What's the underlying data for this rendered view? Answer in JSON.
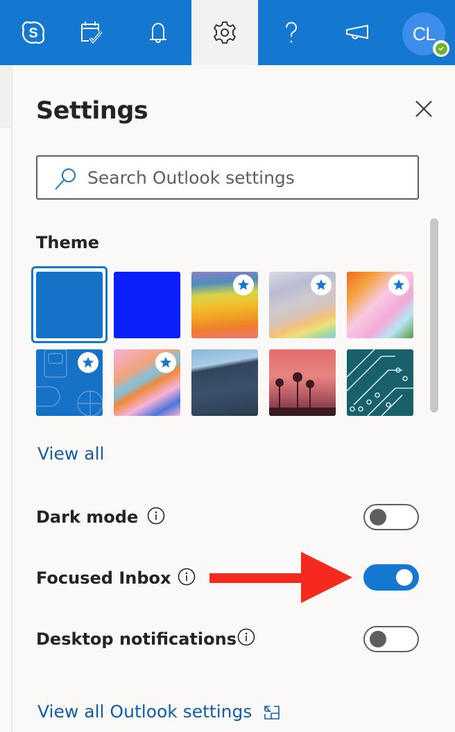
{
  "topbar": {
    "background": "#1478d0",
    "buttons": [
      {
        "name": "skype",
        "icon": "skype-icon"
      },
      {
        "name": "my-day",
        "icon": "calendar-check-icon"
      },
      {
        "name": "notifications",
        "icon": "bell-icon"
      },
      {
        "name": "settings",
        "icon": "gear-icon",
        "active": true
      },
      {
        "name": "help",
        "icon": "question-icon"
      },
      {
        "name": "whats-new",
        "icon": "megaphone-icon"
      }
    ],
    "avatar": {
      "initials": "CL",
      "presence": "available"
    }
  },
  "settings": {
    "title": "Settings",
    "close_icon": "close-icon",
    "search": {
      "placeholder": "Search Outlook settings",
      "value": ""
    },
    "theme": {
      "label": "Theme",
      "tiles": [
        {
          "name": "blue",
          "selected": true,
          "premium": false
        },
        {
          "name": "dark-blue",
          "selected": false,
          "premium": false
        },
        {
          "name": "rainbow-waves",
          "selected": false,
          "premium": true
        },
        {
          "name": "ribbons",
          "selected": false,
          "premium": true
        },
        {
          "name": "unicorn",
          "selected": false,
          "premium": true
        },
        {
          "name": "school-supplies",
          "selected": false,
          "premium": true
        },
        {
          "name": "board-game",
          "selected": false,
          "premium": true
        },
        {
          "name": "mountain",
          "selected": false,
          "premium": false
        },
        {
          "name": "palm-sunset",
          "selected": false,
          "premium": false
        },
        {
          "name": "circuit-board",
          "selected": false,
          "premium": false
        }
      ],
      "view_all": "View all"
    },
    "toggles": [
      {
        "label": "Dark mode",
        "on": false
      },
      {
        "label": "Focused Inbox",
        "on": true
      },
      {
        "label": "Desktop notifications",
        "on": false
      }
    ],
    "footer_link": "View all Outlook settings",
    "footer_icon": "open-in-new-window-icon"
  },
  "annotation": {
    "type": "arrow",
    "color": "#f5291e",
    "points_to": "Focused Inbox toggle"
  },
  "colors": {
    "accent": "#1478d0",
    "link": "#0f5ea8",
    "panel_bg": "#faf9f8"
  }
}
